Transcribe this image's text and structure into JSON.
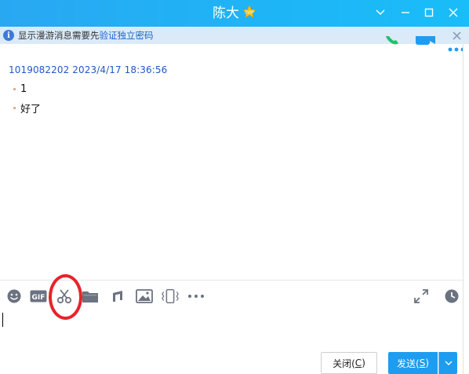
{
  "window": {
    "title": "陈大",
    "colors": {
      "titlebar": "#29a8f2",
      "send_button": "#1e9cf0",
      "highlight": "#e8232a"
    }
  },
  "notice": {
    "text": "显示漫游消息需要先",
    "link": "验证独立密码"
  },
  "messages": [
    {
      "header": "1019082202 2023/4/17 18:36:56",
      "lines": [
        "1",
        "好了"
      ]
    }
  ],
  "toolbar": {
    "items": [
      "emoji-icon",
      "gif-icon",
      "scissors-icon",
      "folder-icon",
      "music-icon",
      "image-icon",
      "shake-icon",
      "more-icon"
    ],
    "right": [
      "expand-icon",
      "history-clock-icon"
    ]
  },
  "buttons": {
    "close_label": "关闭(",
    "close_key": "C",
    "close_tail": ")",
    "send_label": "发送(",
    "send_key": "S",
    "send_tail": ")"
  }
}
